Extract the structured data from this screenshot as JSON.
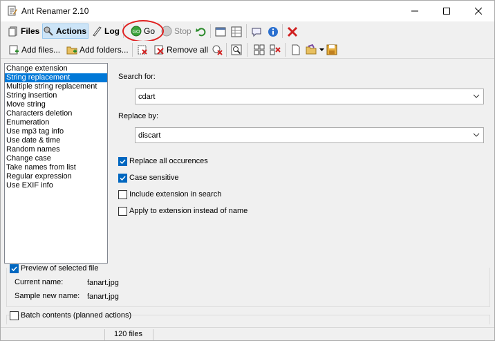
{
  "window": {
    "title": "Ant Renamer 2.10"
  },
  "toolbar1": {
    "files": "Files",
    "actions": "Actions",
    "log": "Log",
    "go": "Go",
    "stop": "Stop"
  },
  "toolbar2": {
    "add_files": "Add files...",
    "add_folders": "Add folders...",
    "remove_all": "Remove all"
  },
  "actions_list": [
    "Change extension",
    "String replacement",
    "Multiple string replacement",
    "String insertion",
    "Move string",
    "Characters deletion",
    "Enumeration",
    "Use mp3 tag info",
    "Use date & time",
    "Random names",
    "Change case",
    "Take names from list",
    "Regular expression",
    "Use EXIF info"
  ],
  "selected_action": "String replacement",
  "form": {
    "search_label": "Search for:",
    "search_value": "cdart",
    "replace_label": "Replace by:",
    "replace_value": "discart",
    "options": [
      {
        "label": "Replace all occurences",
        "checked": true
      },
      {
        "label": "Case sensitive",
        "checked": true
      },
      {
        "label": "Include extension in search",
        "checked": false
      },
      {
        "label": "Apply to extension instead of name",
        "checked": false
      }
    ]
  },
  "preview": {
    "title": "Preview of selected file",
    "checked": true,
    "current_label": "Current name:",
    "current_value": "fanart.jpg",
    "sample_label": "Sample new name:",
    "sample_value": "fanart.jpg"
  },
  "batch": {
    "title": "Batch contents (planned actions)",
    "checked": false
  },
  "status": {
    "files": "120 files"
  },
  "colors": {
    "selection": "#0078d7",
    "checkbox": "#0067c0",
    "highlight_ring": "#e02020"
  }
}
